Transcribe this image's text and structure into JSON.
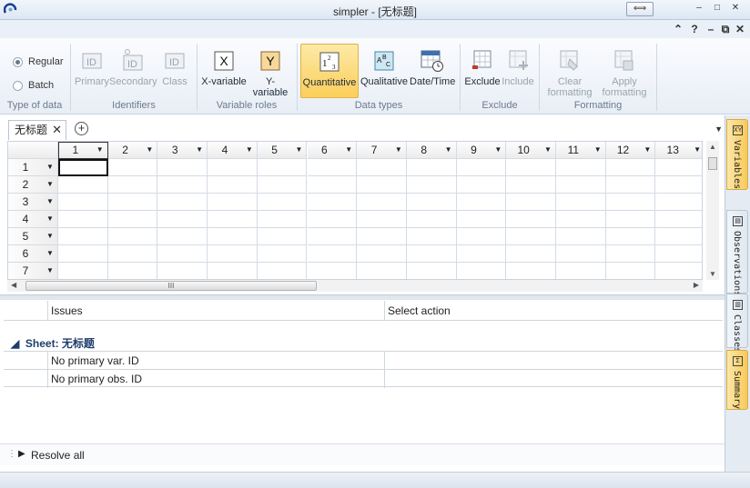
{
  "window": {
    "title": "simpler - [无标题]",
    "restore_glyph": "⟺",
    "min_glyph": "–",
    "max_glyph": "□",
    "close_glyph": "✕"
  },
  "quickbar": {
    "up": "⌃",
    "help": "?",
    "min": "–",
    "restore": "⧉",
    "close": "✕"
  },
  "ribbon": {
    "type_of_data": {
      "label": "Type of data",
      "options": [
        "Regular",
        "Batch"
      ],
      "selected": "Regular"
    },
    "identifiers": {
      "label": "Identifiers",
      "buttons": [
        "Primary",
        "Secondary",
        "Class"
      ]
    },
    "variable_roles": {
      "label": "Variable roles",
      "buttons": [
        "X-variable",
        "Y-variable"
      ],
      "icons": [
        "X",
        "Y"
      ]
    },
    "data_types": {
      "label": "Data types",
      "buttons": [
        "Quantitative",
        "Qualitative",
        "Date/Time"
      ],
      "active": "Quantitative"
    },
    "exclude": {
      "label": "Exclude",
      "buttons": [
        "Exclude",
        "Include"
      ]
    },
    "formatting": {
      "label": "Formatting",
      "buttons": [
        [
          "Clear",
          "formatting"
        ],
        [
          "Apply",
          "formatting"
        ]
      ]
    }
  },
  "doc_tab": {
    "title": "无标题",
    "close": "✕",
    "add": "+"
  },
  "grid": {
    "columns": [
      "1",
      "2",
      "3",
      "4",
      "5",
      "6",
      "7",
      "8",
      "9",
      "10",
      "11",
      "12",
      "13"
    ],
    "rows": [
      "1",
      "2",
      "3",
      "4",
      "5",
      "6",
      "7"
    ],
    "selected_cell": {
      "row": "1",
      "col": "1"
    },
    "hscroll_grip": "III"
  },
  "issues": {
    "header_issues": "Issues",
    "header_action": "Select action",
    "sheet_label": "Sheet: 无标题",
    "items": [
      "No primary var. ID",
      "No primary obs. ID"
    ]
  },
  "resolve": {
    "label": "Resolve all"
  },
  "sidebar": {
    "tabs": [
      {
        "label": "Variables",
        "icon": "XY",
        "active": true
      },
      {
        "label": "Observations",
        "icon": "▤",
        "active": false
      },
      {
        "label": "Classes",
        "icon": "▥",
        "active": false
      },
      {
        "label": "Summary",
        "icon": "Σ",
        "active": true
      }
    ]
  },
  "colors": {
    "accent": "#fbcf5a",
    "ribbon_bg": "#e8eef6",
    "sheet_label": "#1e3d6b"
  }
}
